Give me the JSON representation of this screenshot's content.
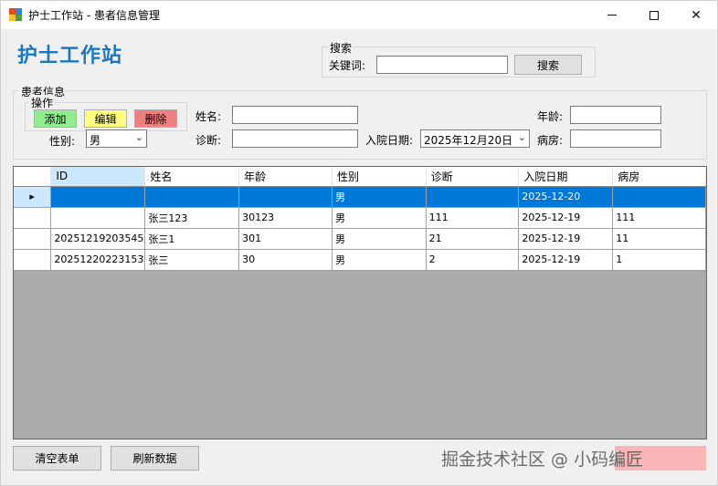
{
  "window": {
    "title": "护士工作站 - 患者信息管理",
    "min_icon": "minimize-icon",
    "max_icon": "maximize-icon",
    "close_icon": "close-icon",
    "close_glyph": "✕"
  },
  "brand": "护士工作站",
  "search": {
    "group_label": "搜索",
    "keyword_label": "关键词:",
    "keyword_value": "",
    "button_label": "搜索"
  },
  "patient": {
    "group_label": "患者信息",
    "ops_label": "操作",
    "add_label": "添加",
    "edit_label": "编辑",
    "delete_label": "删除",
    "add_color": "#90ee90",
    "edit_color": "#ffff80",
    "delete_color": "#f08080",
    "name_label": "姓名:",
    "name_value": "",
    "age_label": "年龄:",
    "age_value": "",
    "gender_label": "性别:",
    "gender_value": "男",
    "diagnosis_label": "诊断:",
    "diagnosis_value": "",
    "admit_label": "入院日期:",
    "admit_value": "2025年12月20日",
    "ward_label": "病房:",
    "ward_value": ""
  },
  "table": {
    "columns": [
      "ID",
      "姓名",
      "年龄",
      "性别",
      "诊断",
      "入院日期",
      "病房"
    ],
    "rows": [
      {
        "id": "",
        "name": "",
        "age": "",
        "gender": "男",
        "diagnosis": "",
        "date": "2025-12-20",
        "ward": "",
        "selected": true
      },
      {
        "id": "",
        "name": "张三123",
        "age": "30123",
        "gender": "男",
        "diagnosis": "111",
        "date": "2025-12-19",
        "ward": "111"
      },
      {
        "id": "20251219203545",
        "name": "张三1",
        "age": "301",
        "gender": "男",
        "diagnosis": "21",
        "date": "2025-12-19",
        "ward": "11"
      },
      {
        "id": "20251220223153",
        "name": "张三",
        "age": "30",
        "gender": "男",
        "diagnosis": "2",
        "date": "2025-12-19",
        "ward": "1"
      }
    ]
  },
  "bottom": {
    "clear_label": "清空表单",
    "refresh_label": "刷新数据"
  },
  "watermark": "掘金技术社区 @ 小码编匠"
}
